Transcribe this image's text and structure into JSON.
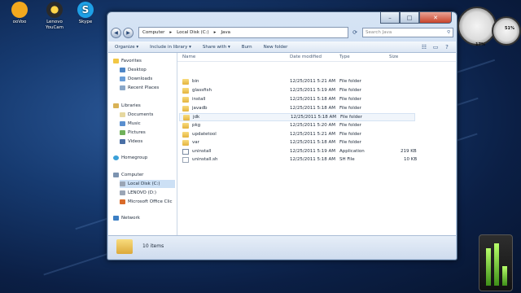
{
  "desktop": {
    "icons": [
      {
        "label": "ooVoo",
        "icon": "oovoo-icon",
        "color": "#f2a81e"
      },
      {
        "label": "Lenovo YouCam",
        "icon": "youcam-icon",
        "color": "#2a2a2a"
      },
      {
        "label": "Skype",
        "icon": "skype-icon",
        "color": "#1ea0e6"
      }
    ]
  },
  "window": {
    "address": {
      "crumbs": [
        "Computer",
        "Local Disk (C:)",
        "Java"
      ]
    },
    "search_placeholder": "Search Java",
    "toolbar": {
      "organize": "Organize ▾",
      "include": "Include in library ▾",
      "share": "Share with ▾",
      "burn": "Burn",
      "new_folder": "New folder"
    },
    "nav": {
      "favorites": "Favorites",
      "desktop": "Desktop",
      "downloads": "Downloads",
      "recent": "Recent Places",
      "libraries": "Libraries",
      "documents": "Documents",
      "music": "Music",
      "pictures": "Pictures",
      "videos": "Videos",
      "homegroup": "Homegroup",
      "computer": "Computer",
      "local_disk": "Local Disk (C:)",
      "lenovo": "LENOVO (D:)",
      "office": "Microsoft Office Clic",
      "network": "Network"
    },
    "columns": {
      "name": "Name",
      "date": "Date modified",
      "type": "Type",
      "size": "Size"
    },
    "files": [
      {
        "name": "bin",
        "date": "12/25/2011 5:21 AM",
        "type": "File folder",
        "size": "",
        "kind": "folder"
      },
      {
        "name": "glassfish",
        "date": "12/25/2011 5:19 AM",
        "type": "File folder",
        "size": "",
        "kind": "folder"
      },
      {
        "name": "install",
        "date": "12/25/2011 5:18 AM",
        "type": "File folder",
        "size": "",
        "kind": "folder"
      },
      {
        "name": "javadb",
        "date": "12/25/2011 5:18 AM",
        "type": "File folder",
        "size": "",
        "kind": "folder"
      },
      {
        "name": "jdk",
        "date": "12/25/2011 5:18 AM",
        "type": "File folder",
        "size": "",
        "kind": "folder"
      },
      {
        "name": "pkg",
        "date": "12/25/2011 5:20 AM",
        "type": "File folder",
        "size": "",
        "kind": "folder"
      },
      {
        "name": "updatetool",
        "date": "12/25/2011 5:21 AM",
        "type": "File folder",
        "size": "",
        "kind": "folder"
      },
      {
        "name": "var",
        "date": "12/25/2011 5:18 AM",
        "type": "File folder",
        "size": "",
        "kind": "folder"
      },
      {
        "name": "uninstall",
        "date": "12/25/2011 5:19 AM",
        "type": "Application",
        "size": "219 KB",
        "kind": "app"
      },
      {
        "name": "uninstall.sh",
        "date": "12/25/2011 5:18 AM",
        "type": "SH File",
        "size": "10 KB",
        "kind": "sh"
      }
    ],
    "status_text": "10 items"
  },
  "gadgets": {
    "cpu": "17%",
    "mem": "51%"
  }
}
